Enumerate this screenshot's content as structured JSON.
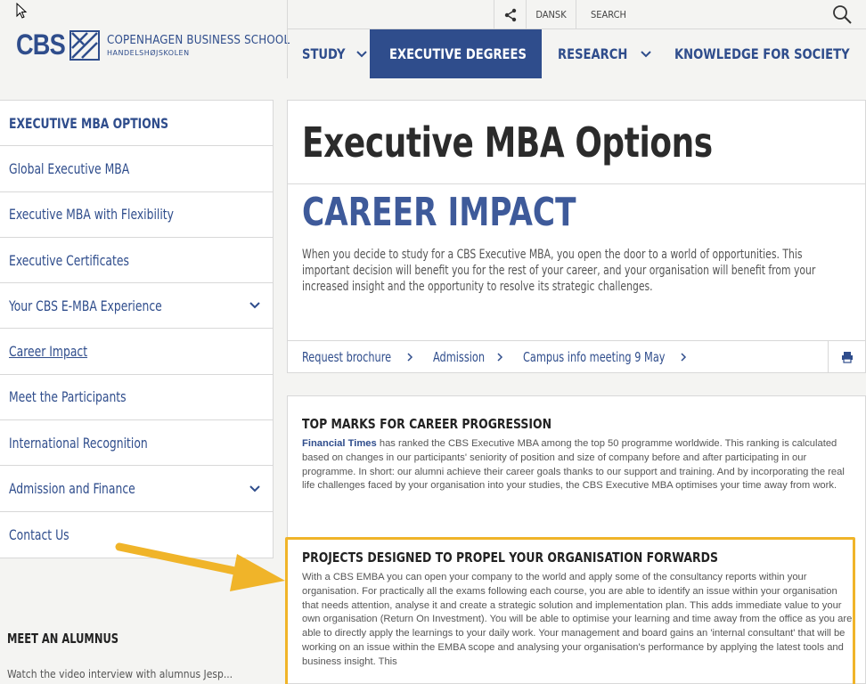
{
  "header": {
    "logo_abbr": "CBS",
    "logo_name": "COPENHAGEN BUSINESS SCHOOL",
    "logo_sub": "HANDELSHØJSKOLEN",
    "language": "DANSK",
    "search_placeholder": "SEARCH"
  },
  "nav": [
    {
      "label": "STUDY",
      "active": false
    },
    {
      "label": "EXECUTIVE DEGREES",
      "active": true
    },
    {
      "label": "RESEARCH",
      "active": false
    },
    {
      "label": "KNOWLEDGE FOR SOCIETY",
      "active": false
    }
  ],
  "sidebar": {
    "heading": "EXECUTIVE MBA OPTIONS",
    "items": [
      {
        "label": "Global Executive MBA"
      },
      {
        "label": "Executive MBA with Flexibility"
      },
      {
        "label": "Executive Certificates"
      },
      {
        "label": "Your CBS E-MBA Experience"
      },
      {
        "label": "Career Impact"
      },
      {
        "label": "Meet the Participants"
      },
      {
        "label": "International Recognition"
      },
      {
        "label": "Admission and Finance"
      },
      {
        "label": "Contact Us"
      }
    ],
    "alumnus_heading": "MEET AN ALUMNUS",
    "alumnus_text": "Watch the video interview with alumnus Jesp..."
  },
  "main": {
    "title": "Executive MBA Options",
    "subtitle": "CAREER IMPACT",
    "intro": "When you decide to study for a CBS Executive MBA, you open the door to a world of opportunities. This important decision will benefit you for the rest of your career, and your organisation will benefit from your increased insight and the opportunity to resolve its strategic challenges.",
    "links": [
      "Request brochure",
      "Admission",
      "Campus info meeting 9 May"
    ]
  },
  "sections": [
    {
      "title": "TOP MARKS FOR CAREER PROGRESSION",
      "lead": "Financial Times",
      "body": " has ranked the CBS Executive MBA among the top 50 programme worldwide. This ranking is calculated based on changes in our participants' seniority of position and size of company before and after participating in our programme. In short: our alumni achieve their career goals thanks to our support and training. And by incorporating the real life challenges faced by your organisation into your studies, the CBS Executive MBA optimises your time away from work."
    },
    {
      "title": "PROJECTS DESIGNED TO PROPEL YOUR ORGANISATION FORWARDS",
      "body": "With a CBS EMBA you can open your company to the world and apply some of the consultancy reports within your organisation. For practically all the exams following each course, you are able to identify an issue within your organisation that needs attention, analyse it and create a strategic solution and implementation plan. This adds immediate value to your own organisation (Return On Investment). You will be able to optimise your learning and time away from the office as you are able to directly apply the learnings to your daily work. Your management and board gains an 'internal consultant' that will be working on an issue within the EMBA scope and analysing your organisation's performance by applying the latest tools and business insight. This"
    }
  ],
  "colors": {
    "brand": "#2f4d8c",
    "highlight": "#f0b429"
  }
}
